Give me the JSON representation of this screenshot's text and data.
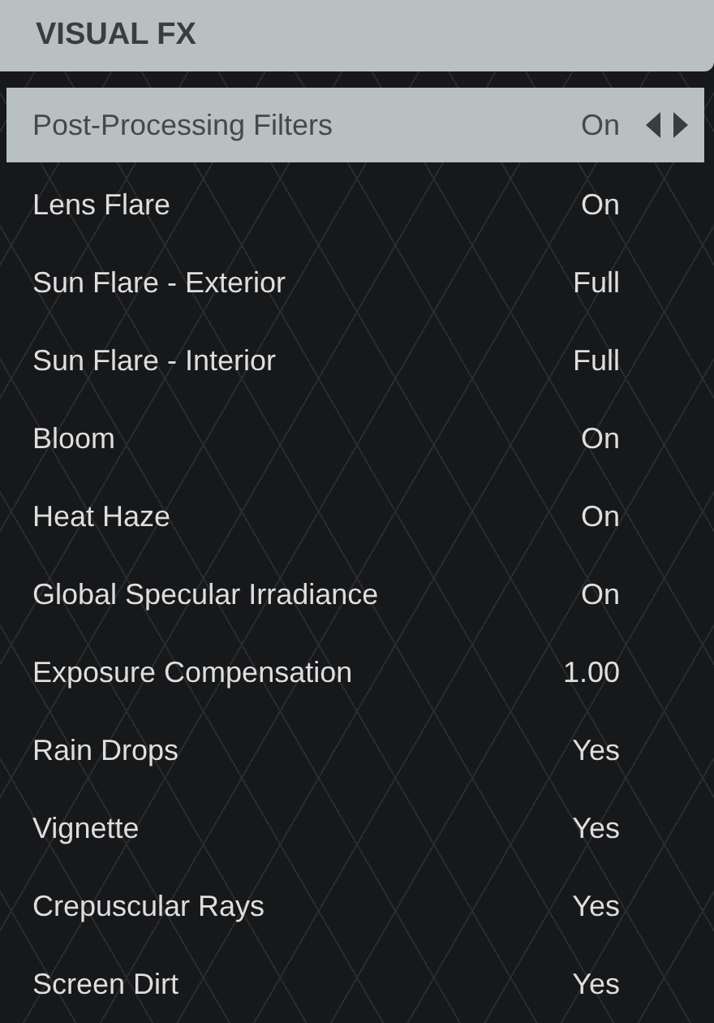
{
  "header": {
    "title": "VISUAL FX"
  },
  "settings": [
    {
      "label": "Post-Processing Filters",
      "value": "On",
      "selected": true
    },
    {
      "label": "Lens Flare",
      "value": "On",
      "selected": false
    },
    {
      "label": "Sun Flare - Exterior",
      "value": "Full",
      "selected": false
    },
    {
      "label": "Sun Flare - Interior",
      "value": "Full",
      "selected": false
    },
    {
      "label": "Bloom",
      "value": "On",
      "selected": false
    },
    {
      "label": "Heat Haze",
      "value": "On",
      "selected": false
    },
    {
      "label": "Global Specular Irradiance",
      "value": "On",
      "selected": false
    },
    {
      "label": "Exposure Compensation",
      "value": "1.00",
      "selected": false
    },
    {
      "label": "Rain Drops",
      "value": "Yes",
      "selected": false
    },
    {
      "label": "Vignette",
      "value": "Yes",
      "selected": false
    },
    {
      "label": "Crepuscular Rays",
      "value": "Yes",
      "selected": false
    },
    {
      "label": "Screen Dirt",
      "value": "Yes",
      "selected": false
    }
  ]
}
